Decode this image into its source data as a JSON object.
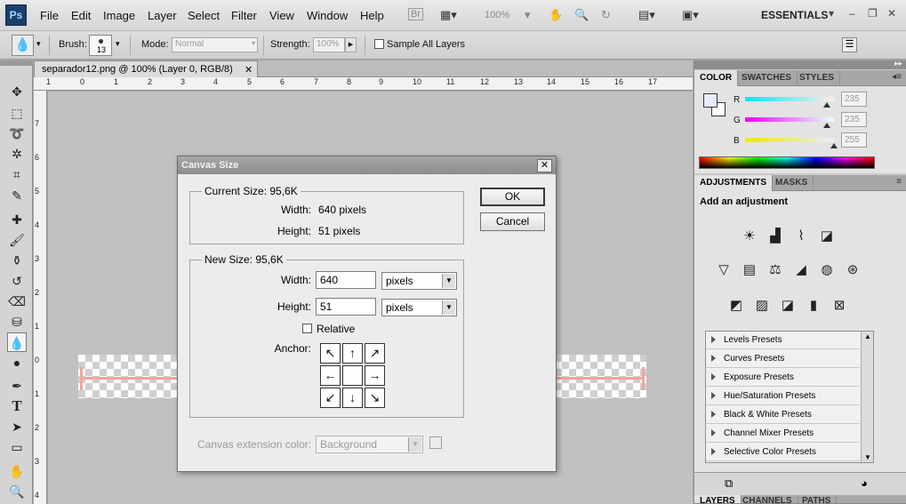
{
  "app": {
    "logo": "Ps",
    "workspace": "ESSENTIALS"
  },
  "menu": [
    "File",
    "Edit",
    "Image",
    "Layer",
    "Select",
    "Filter",
    "View",
    "Window",
    "Help"
  ],
  "menubar_extras": {
    "br": "Br",
    "zoom": "100%"
  },
  "options": {
    "brush_label": "Brush:",
    "brush_size": "13",
    "mode_label": "Mode:",
    "mode_value": "Normal",
    "strength_label": "Strength:",
    "strength_value": "100%",
    "sample_all_layers": "Sample All Layers"
  },
  "document": {
    "tab_title": "separador12.png @ 100% (Layer 0, RGB/8)",
    "ruler_h": [
      "1",
      "0",
      "1",
      "2",
      "3",
      "4",
      "5",
      "6",
      "7",
      "8",
      "9",
      "10",
      "11",
      "12",
      "13",
      "14",
      "15",
      "16",
      "17"
    ],
    "ruler_v": [
      "7",
      "6",
      "5",
      "4",
      "3",
      "2",
      "1",
      "0",
      "1",
      "2",
      "3",
      "4"
    ]
  },
  "color_panel": {
    "tabs": [
      "COLOR",
      "SWATCHES",
      "STYLES"
    ],
    "channels": [
      {
        "label": "R",
        "value": "235",
        "level": 0.92,
        "color": "#2fd8e8"
      },
      {
        "label": "G",
        "value": "235",
        "level": 0.92,
        "color": "#e02fe0"
      },
      {
        "label": "B",
        "value": "255",
        "level": 1.0,
        "color": "#e6e62f"
      }
    ]
  },
  "adjustments_panel": {
    "tabs": [
      "ADJUSTMENTS",
      "MASKS"
    ],
    "header": "Add an adjustment",
    "presets": [
      "Levels Presets",
      "Curves Presets",
      "Exposure Presets",
      "Hue/Saturation Presets",
      "Black & White Presets",
      "Channel Mixer Presets",
      "Selective Color Presets"
    ]
  },
  "layers_panel": {
    "tabs": [
      "LAYERS",
      "CHANNELS",
      "PATHS"
    ]
  },
  "dialog": {
    "title": "Canvas Size",
    "current_size_label": "Current Size: 95,6K",
    "width_label": "Width:",
    "current_width": "640 pixels",
    "height_label": "Height:",
    "current_height": "51 pixels",
    "new_size_label": "New Size: 95,6K",
    "new_width": "640",
    "new_height": "51",
    "width_unit": "pixels",
    "height_unit": "pixels",
    "relative_label": "Relative",
    "anchor_label": "Anchor:",
    "extension_label": "Canvas extension color:",
    "extension_value": "Background",
    "ok_label": "OK",
    "cancel_label": "Cancel"
  }
}
